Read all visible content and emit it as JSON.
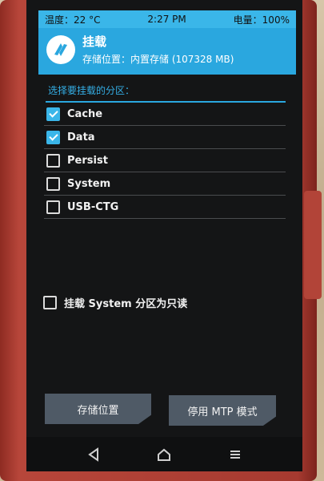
{
  "status_bar": {
    "temperature": "温度：22 °C",
    "time": "2:27 PM",
    "battery": "电量：100%"
  },
  "header": {
    "title": "挂载",
    "subtitle": "存储位置：内置存储 (107328 MB)"
  },
  "section_title": "选择要挂载的分区：",
  "partitions": [
    {
      "label": "Cache",
      "checked": true
    },
    {
      "label": "Data",
      "checked": true
    },
    {
      "label": "Persist",
      "checked": false
    },
    {
      "label": "System",
      "checked": false
    },
    {
      "label": "USB-CTG",
      "checked": false
    }
  ],
  "readonly_option": {
    "label": "挂载 System 分区为只读",
    "checked": false
  },
  "buttons": {
    "storage": "存储位置",
    "mtp": "停用 MTP 模式"
  },
  "navbar_icons": [
    "back-icon",
    "home-icon",
    "menu-icon"
  ],
  "colors": {
    "accent": "#2aa7df",
    "background": "#141516",
    "button": "#4f5a66"
  }
}
